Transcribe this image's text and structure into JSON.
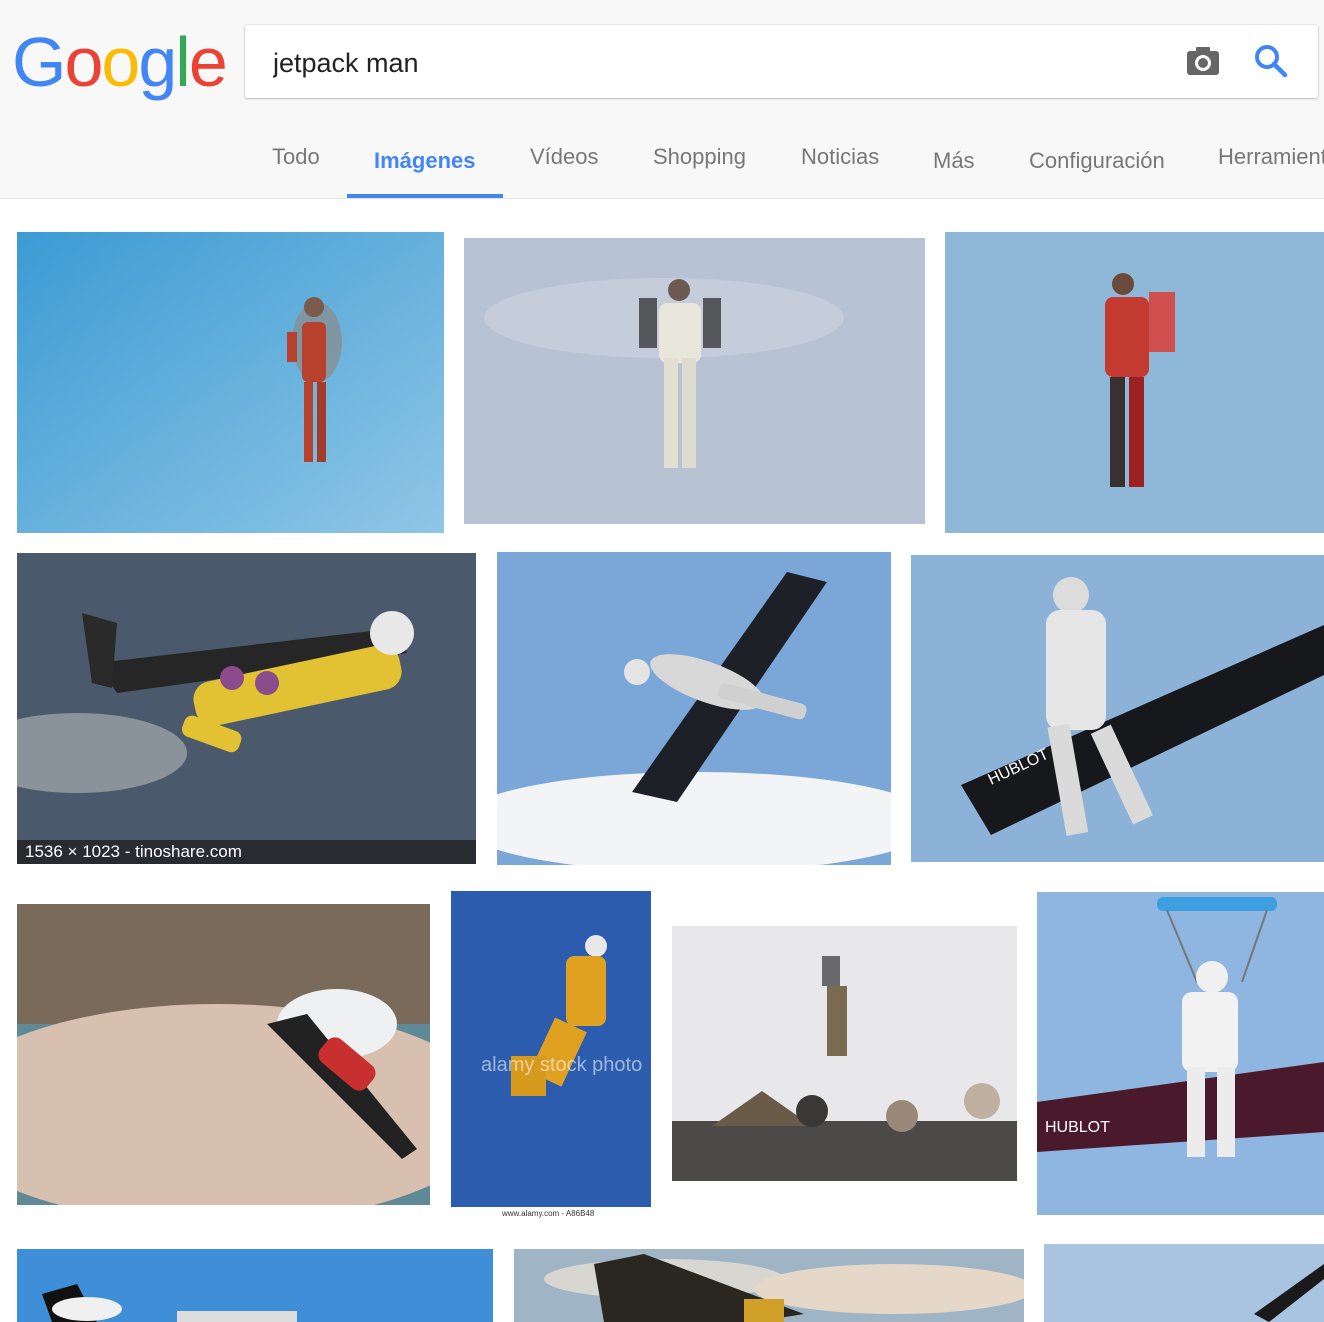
{
  "logo": {
    "letters": [
      "G",
      "o",
      "o",
      "g",
      "l",
      "e"
    ]
  },
  "search": {
    "query": "jetpack man"
  },
  "tabs": {
    "todo": "Todo",
    "imagenes": "Imágenes",
    "videos": "Vídeos",
    "shopping": "Shopping",
    "noticias": "Noticias",
    "mas": "Más",
    "configuracion": "Configuración",
    "herramientas": "Herramientas"
  },
  "results": {
    "hover_info": "1536 × 1023 - tinoshare.com",
    "watermark": "alamy stock photo",
    "source_caption": "www.alamy.com - A86B48"
  },
  "colors": {
    "google_blue": "#4285f4",
    "google_red": "#ea4335",
    "google_yellow": "#fbbc05",
    "google_green": "#34a853"
  }
}
